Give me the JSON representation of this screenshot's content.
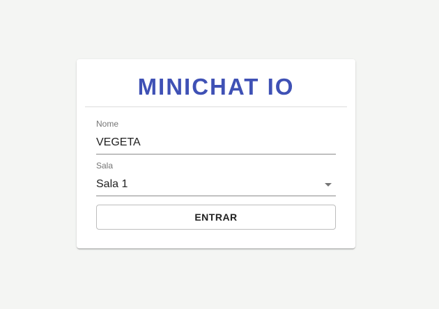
{
  "app": {
    "title": "MINICHAT IO"
  },
  "form": {
    "name_field": {
      "label": "Nome",
      "value": "VEGETA"
    },
    "room_field": {
      "label": "Sala",
      "value": "Sala 1"
    },
    "enter_label": "ENTRAR"
  },
  "colors": {
    "background": "#f4f5f3",
    "accent": "#3f51b5",
    "card": "#ffffff"
  }
}
